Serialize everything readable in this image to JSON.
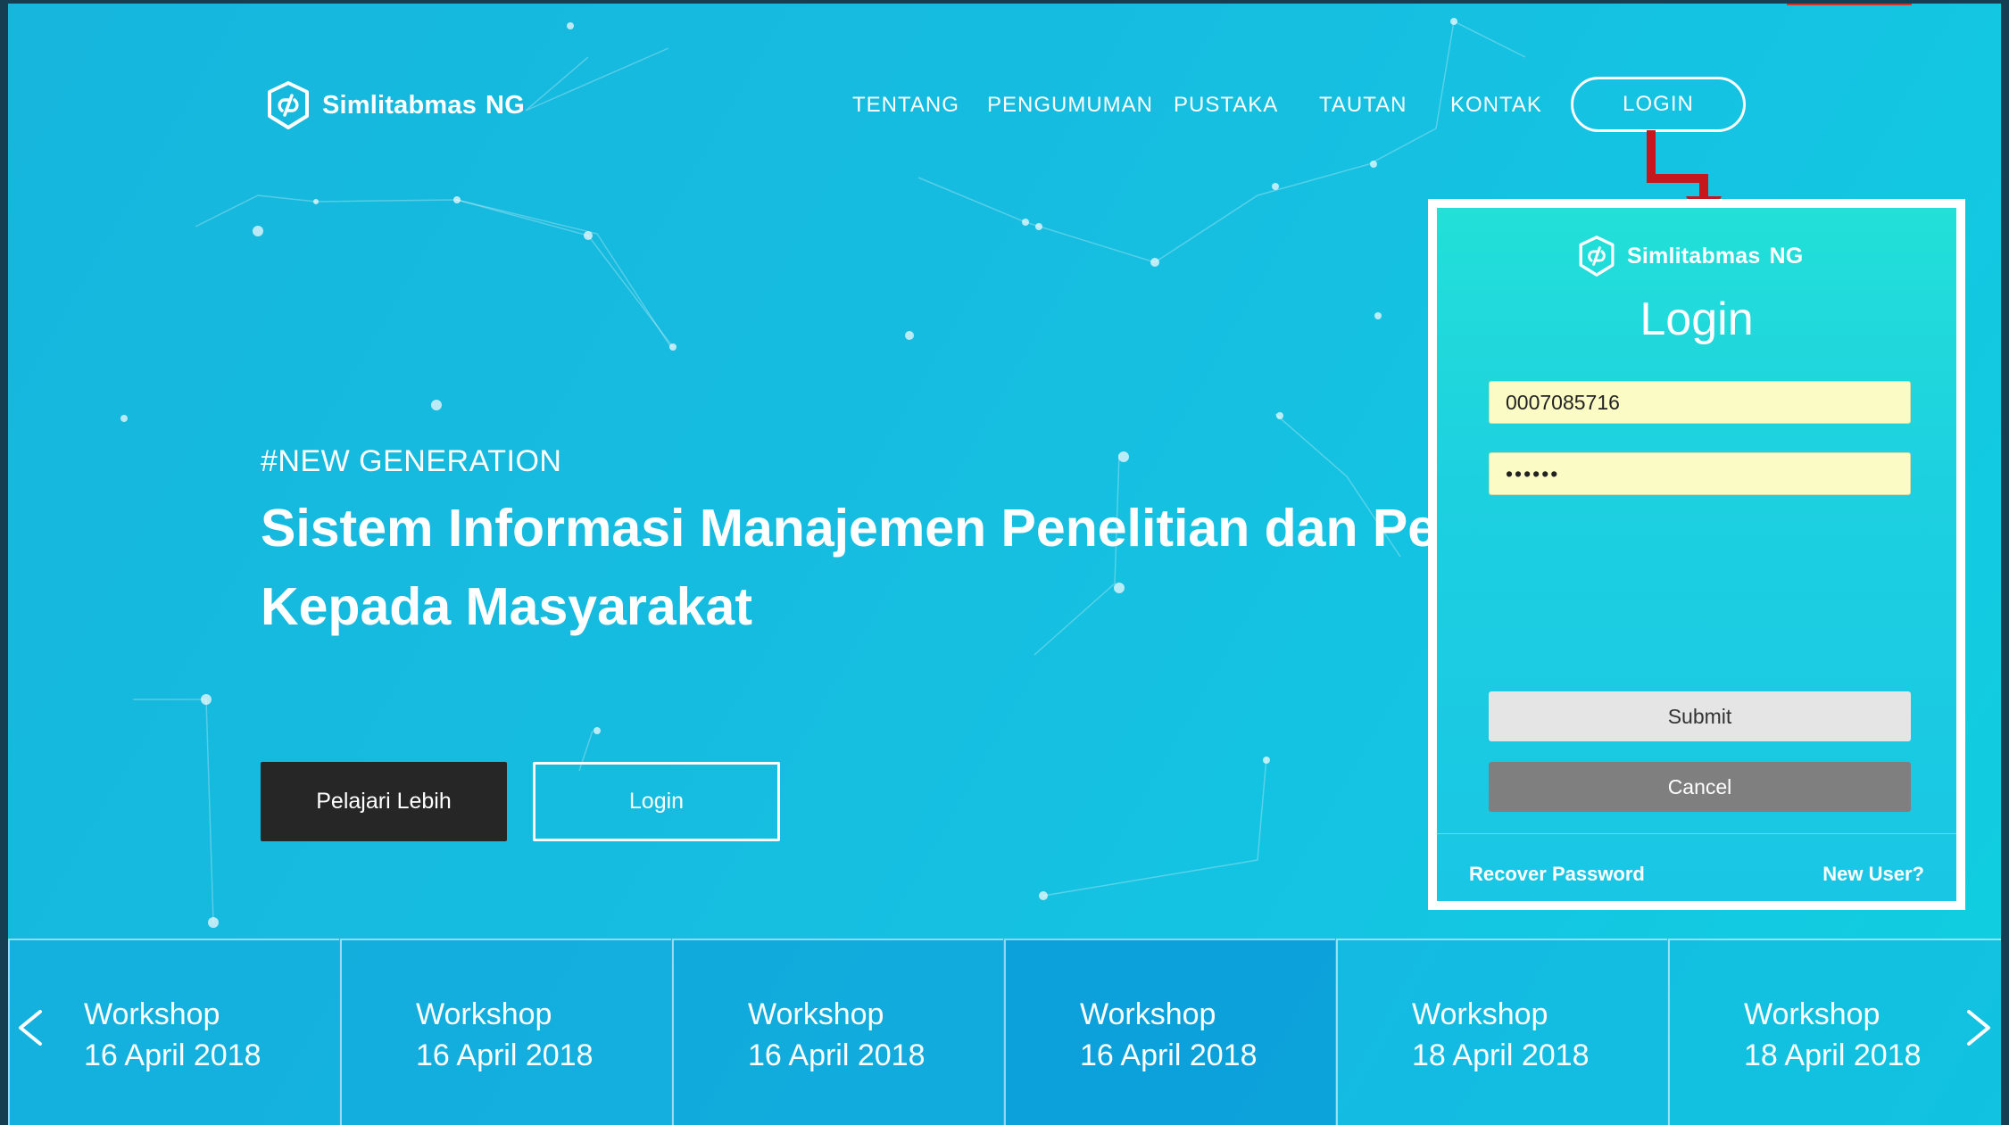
{
  "brand": {
    "name": "Simlitabmas",
    "suffix": "NG"
  },
  "nav": {
    "items": [
      "TENTANG",
      "PENGUMUMAN",
      "PUSTAKA",
      "TAUTAN",
      "KONTAK"
    ],
    "login_label": "LOGIN"
  },
  "hero": {
    "tag": "#NEW GENERATION",
    "title_line1": "Sistem Informasi Manajemen Penelitian dan Pengabdian",
    "title_line2": "Kepada Masyarakat",
    "learn_more_label": "Pelajari Lebih",
    "login_label": "Login"
  },
  "login_modal": {
    "title": "Login",
    "username_value": "0007085716",
    "password_value": "••••••",
    "submit_label": "Submit",
    "cancel_label": "Cancel",
    "recover_label": "Recover Password",
    "new_user_label": "New User?"
  },
  "events": [
    {
      "title": "Workshop",
      "date": "16 April 2018"
    },
    {
      "title": "Workshop",
      "date": "16 April 2018"
    },
    {
      "title": "Workshop",
      "date": "16 April 2018"
    },
    {
      "title": "Workshop",
      "date": "16 April 2018"
    },
    {
      "title": "Workshop",
      "date": "18 April 2018"
    },
    {
      "title": "Workshop",
      "date": "18 April 2018"
    }
  ],
  "icons": {
    "brand": "shield-link-icon",
    "callout": "red-arrow-icon",
    "prev": "chevron-left-icon",
    "next": "chevron-right-icon"
  },
  "colors": {
    "background": "#16bde0",
    "modal": "#1fd6dc",
    "input_fill": "#fbfbc6",
    "dark_button": "#262626",
    "cancel_button": "#7f7f7f",
    "arrow": "#c8161d"
  }
}
